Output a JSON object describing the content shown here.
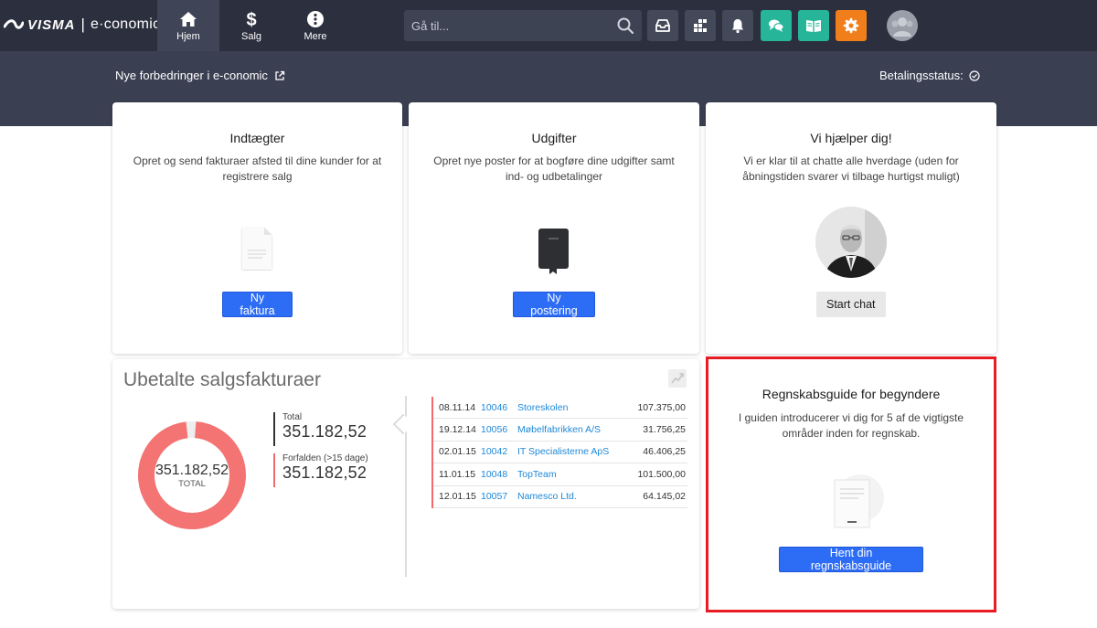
{
  "header": {
    "logo_brand": "VISMA",
    "logo_separator": "|",
    "logo_product": "e·conomic",
    "nav": [
      {
        "label": "Hjem",
        "icon": "home-icon"
      },
      {
        "label": "Salg",
        "icon": "dollar-icon"
      },
      {
        "label": "Mere",
        "icon": "more-icon"
      }
    ],
    "search_placeholder": "Gå til...",
    "toolbar_icons": [
      "inbox-icon",
      "apps-icon",
      "bell-icon",
      "chat-icon",
      "book-icon",
      "gear-icon"
    ],
    "colors": {
      "bar": "#2b2f3e",
      "teal": "#27b59a",
      "orange": "#f07f1b"
    }
  },
  "subheader": {
    "news_link": "Nye forbedringer i e-conomic",
    "payment_status": "Betalingsstatus:"
  },
  "cards": {
    "income": {
      "title": "Indtægter",
      "description": "Opret og send fakturaer afsted til dine kunder for at registrere salg",
      "button": "Ny faktura"
    },
    "expenses": {
      "title": "Udgifter",
      "description": "Opret nye poster for at bogføre dine udgifter samt ind- og udbetalinger",
      "button": "Ny postering"
    },
    "help": {
      "title": "Vi hjælper dig!",
      "description": "Vi er klar til at chatte alle hverdage (uden for åbningstiden svarer vi tilbage hurtigst muligt)",
      "button": "Start chat"
    },
    "guide": {
      "title": "Regnskabsguide for begyndere",
      "description": "I guiden introducerer vi dig for 5 af de vigtigste områder inden for regnskab.",
      "button": "Hent din regnskabsguide"
    }
  },
  "unpaid": {
    "title": "Ubetalte salgsfakturaer",
    "donut_value": "351.182,52",
    "donut_label": "TOTAL",
    "overdue_fraction": 0.98,
    "donut_color": "#f47373",
    "total_label": "Total",
    "total_value": "351.182,52",
    "overdue_label": "Forfalden (>15 dage)",
    "overdue_value": "351.182,52",
    "invoices": [
      {
        "date": "08.11.14",
        "number": "10046",
        "customer": "Storeskolen",
        "amount": "107.375,00"
      },
      {
        "date": "19.12.14",
        "number": "10056",
        "customer": "Møbelfabrikken A/S",
        "amount": "31.756,25"
      },
      {
        "date": "02.01.15",
        "number": "10042",
        "customer": "IT Specialisterne ApS",
        "amount": "46.406,25"
      },
      {
        "date": "11.01.15",
        "number": "10048",
        "customer": "TopTeam",
        "amount": "101.500,00"
      },
      {
        "date": "12.01.15",
        "number": "10057",
        "customer": "Namesco Ltd.",
        "amount": "64.145,02"
      }
    ]
  }
}
